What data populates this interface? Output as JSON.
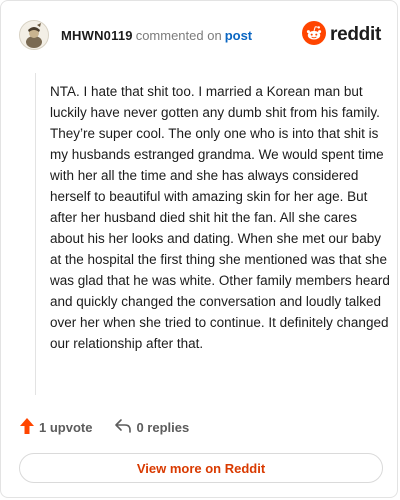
{
  "comment": {
    "username": "MHWN0119",
    "meta_text": "commented on",
    "post_link": "post",
    "text": "NTA. I hate that shit too. I married a Korean man but luckily have never gotten any dumb shit from his family. They’re super cool. The only one who is into that shit is my husbands estranged grandma. We would spent time with her all the time and she has always considered herself to beautiful with amazing skin for her age. But after her husband died shit hit the fan. All she cares about his her looks and dating. When she met our baby at the hospital the first thing she mentioned was that she was glad that he was white. Other family members heard and quickly changed the conversation and loudly talked over her when she tried to continue. It definitely changed our relationship after that."
  },
  "brand": {
    "name": "reddit",
    "accent_color": "#ff4500"
  },
  "actions": {
    "upvote_label": "1 upvote",
    "replies_label": "0 replies"
  },
  "footer": {
    "view_more_label": "View more on Reddit"
  },
  "icons": {
    "avatar": "avatar-icon",
    "brand": "reddit-logo-icon",
    "upvote": "upvote-arrow-icon",
    "reply": "reply-arrow-icon"
  }
}
